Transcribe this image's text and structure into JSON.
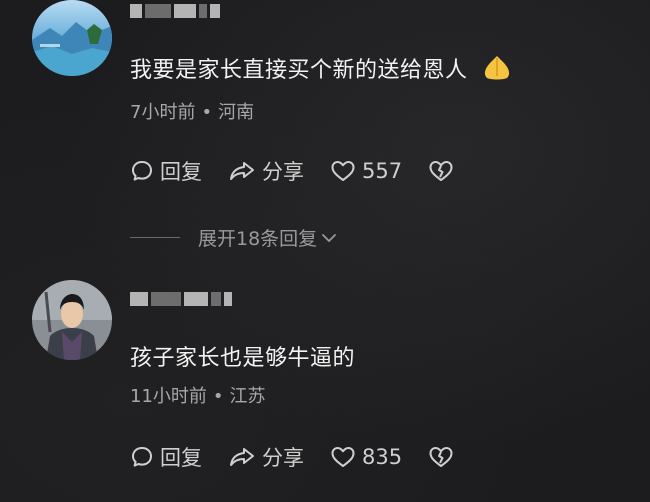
{
  "comments": [
    {
      "text": "我要是家长直接买个新的送给恩人",
      "emoji": "praying-hands",
      "time": "7小时前",
      "separator": "•",
      "location": "河南",
      "reply_label": "回复",
      "share_label": "分享",
      "likes": "557"
    },
    {
      "text": "孩子家长也是够牛逼的",
      "time": "11小时前",
      "separator": "•",
      "location": "江苏",
      "reply_label": "回复",
      "share_label": "分享",
      "likes": "835"
    }
  ],
  "expand": {
    "label": "展开18条回复"
  },
  "icons": [
    "comment-icon",
    "share-icon",
    "heart-icon",
    "broken-heart-icon",
    "chevron-down-icon"
  ],
  "colors": {
    "background": "#1c1c1e",
    "text": "#f2f2f2",
    "muted": "#a7a7a7"
  }
}
